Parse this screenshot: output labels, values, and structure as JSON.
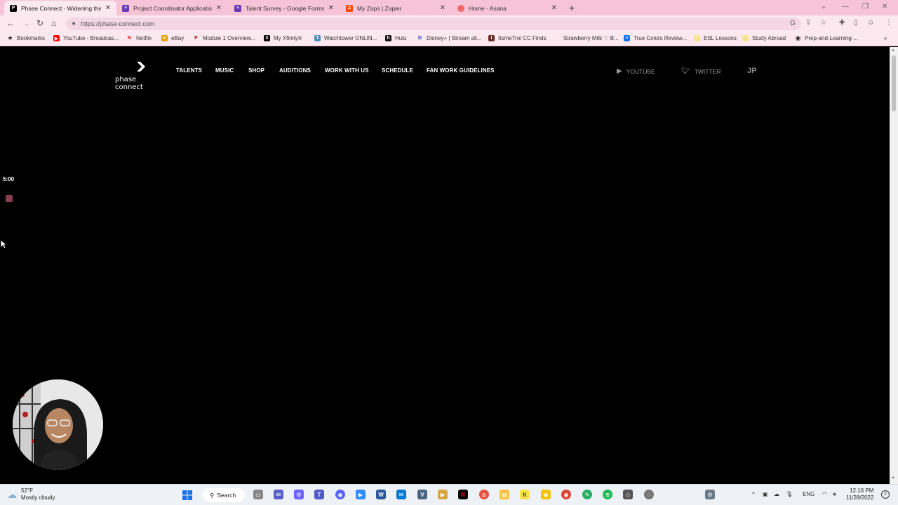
{
  "tabs": [
    {
      "title": "Phase Connect - Widening the V",
      "active": true,
      "favicon_color": "#000000",
      "favicon_glyph": "P"
    },
    {
      "title": "Project Coordinator Application",
      "active": false,
      "favicon_color": "#673ab7",
      "favicon_glyph": "≡"
    },
    {
      "title": "Talent Survey - Google Forms",
      "active": false,
      "favicon_color": "#673ab7",
      "favicon_glyph": "≡"
    },
    {
      "title": "My Zaps | Zapier",
      "active": false,
      "favicon_color": "#ff4a00",
      "favicon_glyph": "Z"
    },
    {
      "title": "Home - Asana",
      "active": false,
      "favicon_color": "#f06a6a",
      "favicon_glyph": "●"
    }
  ],
  "toolbar": {
    "url": "https://phase-connect.com"
  },
  "bookmarks": [
    {
      "label": "Bookmarks",
      "color": "#333333",
      "glyph": "★"
    },
    {
      "label": "YouTube - Broadcas...",
      "color": "#ff0000",
      "glyph": "▶"
    },
    {
      "label": "Netflix",
      "color": "#e50914",
      "glyph": "N"
    },
    {
      "label": "eBay",
      "color": "#e1a200",
      "glyph": "e"
    },
    {
      "label": "Module 1 Overview...",
      "color": "#8b1a1a",
      "glyph": "P"
    },
    {
      "label": "My Xfinity®",
      "color": "#000000",
      "glyph": "X"
    },
    {
      "label": "Watchtower ONLIN...",
      "color": "#4a90c2",
      "glyph": "T"
    },
    {
      "label": "Hulu",
      "color": "#111111",
      "glyph": "h"
    },
    {
      "label": "Disney+ | Stream all...",
      "color": "#113ccf",
      "glyph": "D"
    },
    {
      "label": "ItsmeTroi CC Finds",
      "color": "#6b2a2a",
      "glyph": "I"
    },
    {
      "label": "Strawberry Milk ♡ B...",
      "color": "#fce9f0",
      "glyph": ""
    },
    {
      "label": "True Colors Review...",
      "color": "#1a73e8",
      "glyph": "≡"
    },
    {
      "label": "ESL Lessons",
      "color": "#f6e58d",
      "glyph": ""
    },
    {
      "label": "Study Abroad",
      "color": "#f6e58d",
      "glyph": ""
    },
    {
      "label": "Prep-and-Learning-...",
      "color": "#222222",
      "glyph": "◉"
    }
  ],
  "site": {
    "logo_text": "phase connect",
    "nav": [
      "TALENTS",
      "MUSIC",
      "SHOP",
      "AUDITIONS",
      "WORK WITH US",
      "SCHEDULE",
      "FAN WORK GUIDELINES"
    ],
    "social": [
      {
        "label": "YOUTUBE",
        "icon": "youtube-icon"
      },
      {
        "label": "TWITTER",
        "icon": "twitter-icon"
      }
    ],
    "language": "JP"
  },
  "recorder": {
    "timer": "5:00"
  },
  "taskbar": {
    "weather_temp": "52°F",
    "weather_desc": "Mostly cloudy",
    "search_label": "Search",
    "lang": "ENG",
    "time": "12:16 PM",
    "date": "11/28/2022",
    "notifications": "2"
  }
}
